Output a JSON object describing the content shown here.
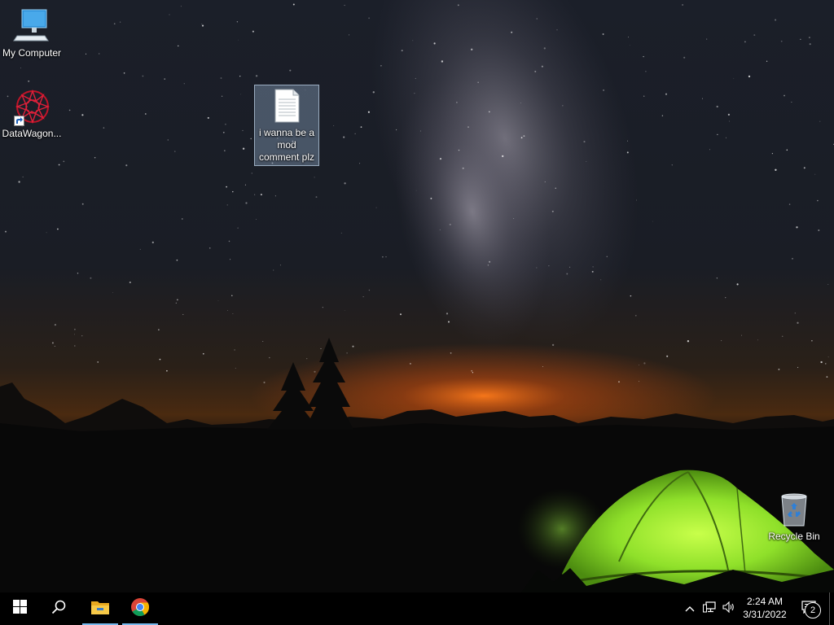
{
  "desktop": {
    "icons": [
      {
        "label": "My Computer",
        "icon": "computer-icon"
      },
      {
        "label": "DataWagon...",
        "icon": "datawagon-icon"
      },
      {
        "label": "i wanna be a mod comment plz",
        "icon": "text-document-icon"
      },
      {
        "label": "Recycle Bin",
        "icon": "recycle-bin-icon"
      }
    ]
  },
  "taskbar": {
    "start_icon": "windows-logo-icon",
    "search_icon": "search-icon",
    "pinned": [
      {
        "name": "File Explorer",
        "icon": "file-explorer-icon"
      },
      {
        "name": "Google Chrome",
        "icon": "chrome-icon"
      }
    ],
    "tray": {
      "icons": [
        "chevron-up-icon",
        "network-icon",
        "volume-icon"
      ],
      "time": "2:24 AM",
      "date": "3/31/2022",
      "notification_count": "2"
    }
  },
  "colors": {
    "taskbar": "#000000",
    "accent": "#76b9ed",
    "tent": "#8fe02a",
    "horizon_glow": "#ff7a1a"
  }
}
